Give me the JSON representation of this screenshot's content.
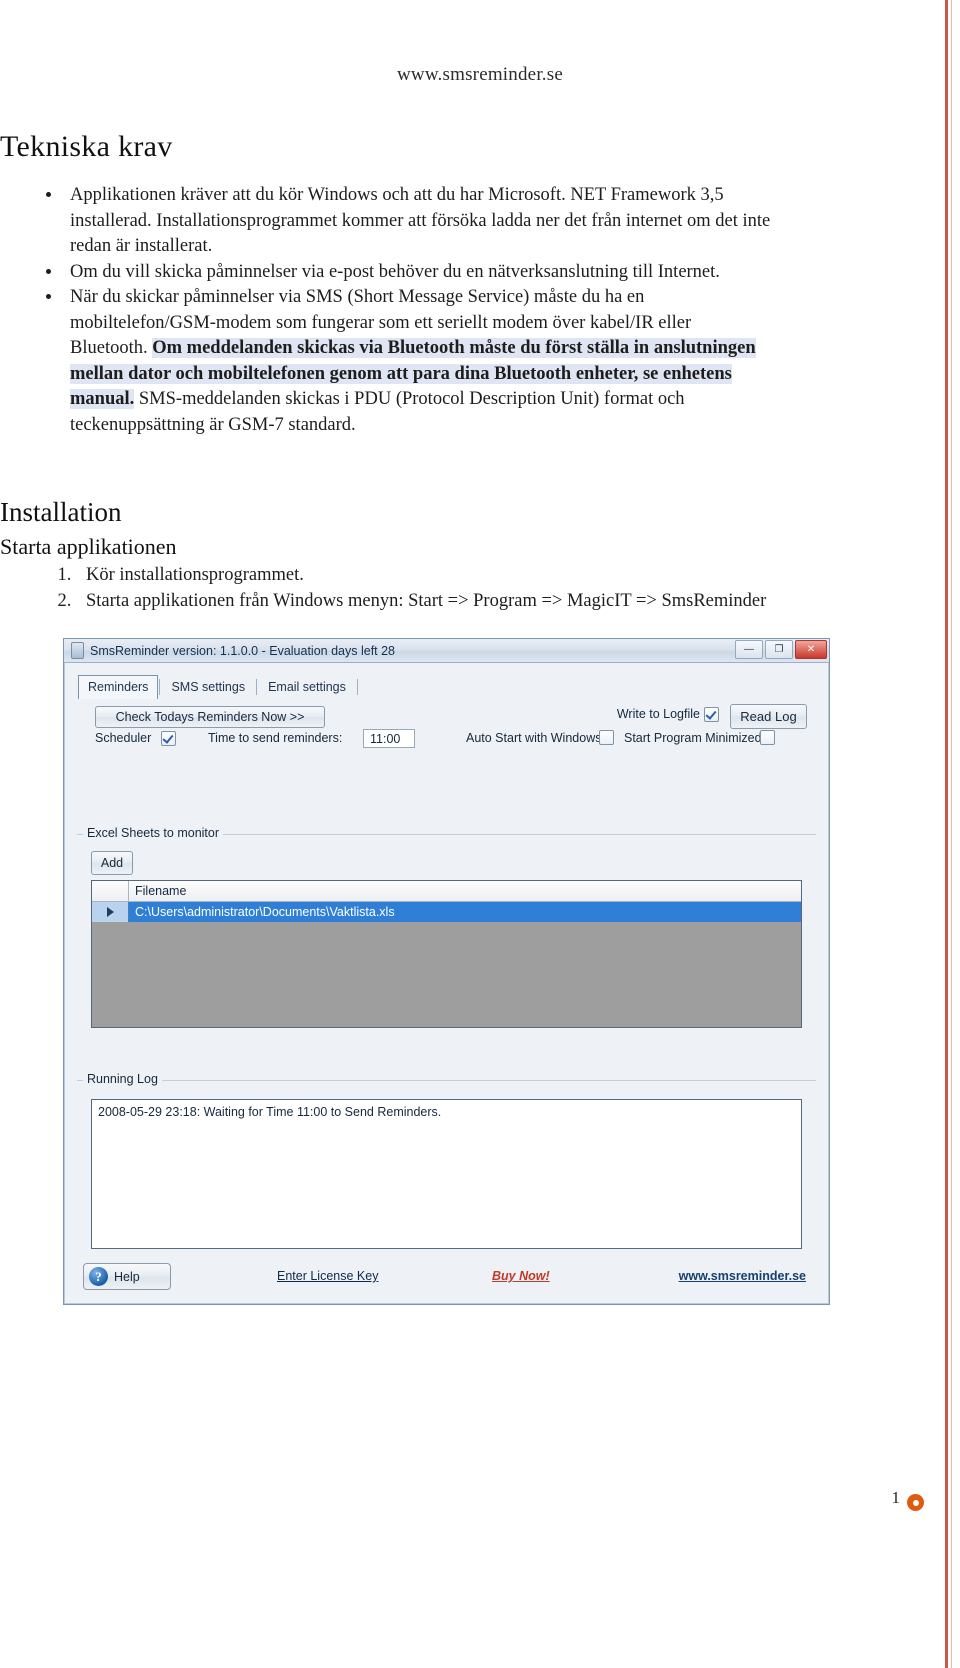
{
  "header": {
    "site_url": "www.smsreminder.se"
  },
  "sections": {
    "tech_heading": "Tekniska krav",
    "install_heading": "Installation",
    "start_heading": "Starta applikationen"
  },
  "bullets": [
    {
      "parts": [
        {
          "text": "Applikationen kräver att du kör Windows och att du har Microsoft. NET Framework 3,5 installerad.  Installationsprogrammet kommer att försöka ladda ner det från internet om det inte redan är installerat.",
          "style": "normal"
        }
      ]
    },
    {
      "parts": [
        {
          "text": " Om du vill skicka påminnelser via e-post behöver du en nätverksanslutning till Internet.",
          "style": "normal"
        }
      ]
    },
    {
      "parts": [
        {
          "text": " När du skickar påminnelser via SMS (Short Message Service) måste du ha en mobiltelefon/GSM-modem som fungerar som ett seriellt modem över kabel/IR eller Bluetooth. ",
          "style": "normal"
        },
        {
          "text": "Om meddelanden skickas via Bluetooth måste du först ställa in anslutningen mellan dator och mobiltelefonen genom att para dina Bluetooth enheter, se enhetens manual.",
          "style": "highlight-bold"
        },
        {
          "text": " SMS-meddelanden skickas i PDU (Protocol Description Unit) format och teckenuppsättning är GSM-7 standard.",
          "style": "normal"
        }
      ]
    }
  ],
  "steps": [
    "Kör installationsprogrammet.",
    "Starta applikationen från Windows menyn: Start => Program => MagicIT => SmsReminder"
  ],
  "app": {
    "title": "SmsReminder version: 1.1.0.0 - Evaluation days left 28",
    "window_buttons": {
      "minimize": "—",
      "maximize": "❐",
      "close": "✕"
    },
    "tabs": [
      {
        "label": "Reminders",
        "active": true
      },
      {
        "label": "SMS settings",
        "active": false
      },
      {
        "label": "Email settings",
        "active": false
      }
    ],
    "check_button": "Check Todays Reminders Now >>",
    "scheduler_label": "Scheduler",
    "scheduler_checked": true,
    "time_label": "Time to send reminders:",
    "time_value": "11:00",
    "write_log_label": "Write to Logfile",
    "write_log_checked": true,
    "read_log_button": "Read Log",
    "auto_start_label": "Auto Start with Windows",
    "auto_start_checked": false,
    "start_min_label": "Start Program Minimized",
    "start_min_checked": false,
    "excel_group_title": "Excel Sheets to monitor",
    "add_button": "Add",
    "grid": {
      "columns": [
        "Filename"
      ],
      "rows": [
        {
          "selected": true,
          "filename": "C:\\Users\\administrator\\Documents\\Vaktlista.xls"
        }
      ]
    },
    "log_group_title": "Running Log",
    "log_text": "2008-05-29 23:18: Waiting for Time 11:00 to Send Reminders.",
    "footer": {
      "help": "Help",
      "help_icon_glyph": "?",
      "license": "Enter License Key ",
      "buy": "Buy Now!",
      "site": "www.smsreminder.se"
    }
  },
  "page_footer": {
    "page_number": "1"
  },
  "colors": {
    "accent_red": "#c0392b",
    "selection_blue": "#2f7fd6",
    "highlight": "#dfe5f2",
    "logo_orange": "#e05a10"
  }
}
